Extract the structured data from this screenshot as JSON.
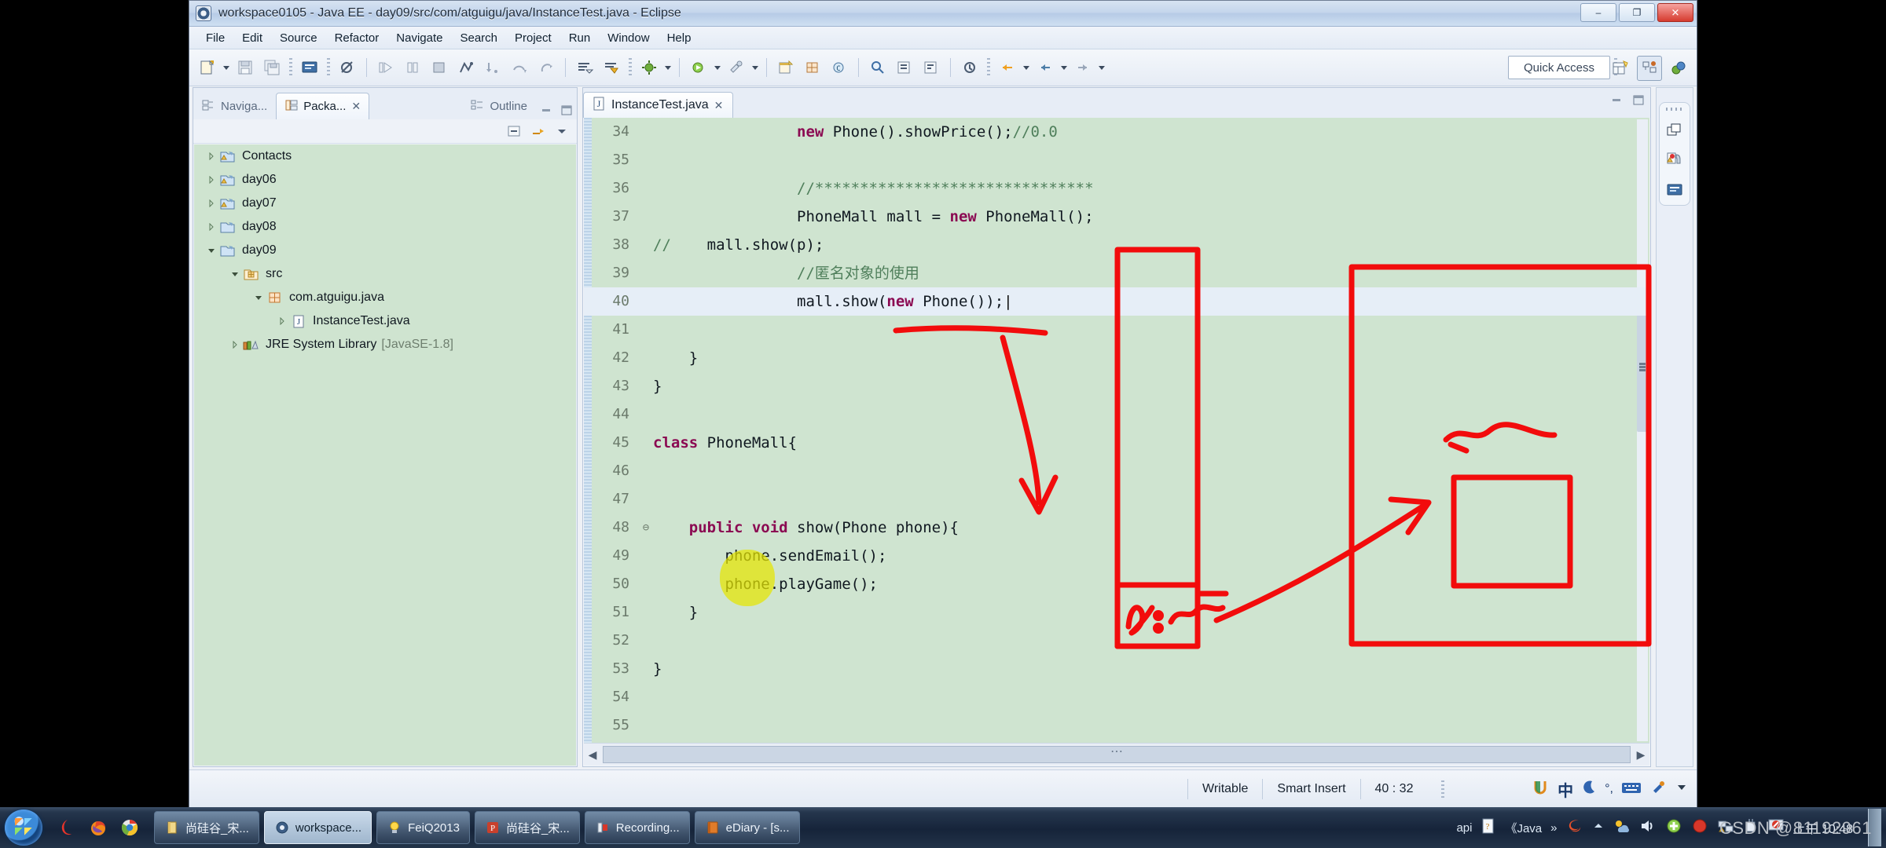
{
  "window": {
    "title": "workspace0105 - Java EE - day09/src/com/atguigu/java/InstanceTest.java - Eclipse",
    "minimize_label": "–",
    "maximize_label": "❐",
    "close_label": "✕"
  },
  "menu": [
    "File",
    "Edit",
    "Source",
    "Refactor",
    "Navigate",
    "Search",
    "Project",
    "Run",
    "Window",
    "Help"
  ],
  "toolbar": {
    "quick_access": "Quick Access",
    "icons": [
      "new-icon",
      "dropdown-caret",
      "save-icon",
      "save-all-icon",
      "console-icon",
      "skip-breakpoints-icon",
      "run-icon",
      "pause-icon",
      "stop-icon",
      "step-icon",
      "step-into-icon",
      "step-over-icon",
      "step-return-icon",
      "next-annotation-icon",
      "previous-annotation-icon",
      "debug-icon",
      "open-type-icon"
    ],
    "perspective_icons": [
      "new-perspective-icon",
      "java-ee-perspective-icon",
      "java-perspective-icon"
    ]
  },
  "left_panel": {
    "tabs": [
      {
        "label": "Naviga...",
        "icon": "navigator-icon",
        "active": false
      },
      {
        "label": "Packa...",
        "icon": "package-explorer-icon",
        "active": true
      }
    ],
    "close_label": "✕",
    "view_tools": [
      "collapse-all-icon",
      "link-with-editor-icon",
      "view-menu-icon"
    ],
    "minimize_label": "▭",
    "maximize_label": "▣",
    "tree": [
      {
        "label": "Contacts",
        "icon": "java-project-warning-icon",
        "indent": 0,
        "state": "collapsed"
      },
      {
        "label": "day06",
        "icon": "java-project-warning-icon",
        "indent": 0,
        "state": "collapsed"
      },
      {
        "label": "day07",
        "icon": "java-project-warning-icon",
        "indent": 0,
        "state": "collapsed"
      },
      {
        "label": "day08",
        "icon": "java-project-icon",
        "indent": 0,
        "state": "collapsed"
      },
      {
        "label": "day09",
        "icon": "java-project-icon",
        "indent": 0,
        "state": "expanded"
      },
      {
        "label": "src",
        "icon": "source-folder-icon",
        "indent": 1,
        "state": "expanded"
      },
      {
        "label": "com.atguigu.java",
        "icon": "package-icon",
        "indent": 2,
        "state": "expanded"
      },
      {
        "label": "InstanceTest.java",
        "icon": "java-file-icon",
        "indent": 3,
        "state": "collapsed"
      },
      {
        "label": "JRE System Library",
        "suffix": "[JavaSE-1.8]",
        "icon": "library-icon",
        "indent": 1,
        "state": "collapsed"
      }
    ]
  },
  "editor": {
    "tab": {
      "label": "InstanceTest.java",
      "icon": "java-file-icon",
      "close_label": "✕"
    },
    "minimize_label": "▭",
    "maximize_label": "▣",
    "cursor_line": 40,
    "lines": [
      {
        "n": 34,
        "fold": "",
        "indent": 4,
        "tokens": [
          {
            "t": "new",
            "c": "kw"
          },
          {
            "t": " Phone().showPrice();",
            "c": "src"
          },
          {
            "t": "//0.0",
            "c": "cm"
          }
        ]
      },
      {
        "n": 35,
        "fold": "",
        "indent": 0,
        "tokens": []
      },
      {
        "n": 36,
        "fold": "",
        "indent": 4,
        "tokens": [
          {
            "t": "//*******************************",
            "c": "cm"
          }
        ]
      },
      {
        "n": 37,
        "fold": "",
        "indent": 4,
        "tokens": [
          {
            "t": "PhoneMall mall = ",
            "c": "src"
          },
          {
            "t": "new",
            "c": "kw"
          },
          {
            "t": " PhoneMall();",
            "c": "src"
          }
        ]
      },
      {
        "n": 38,
        "fold": "",
        "indent": 0,
        "prefix": "//",
        "tokens": [
          {
            "t": "    mall.show(p);",
            "c": "src"
          }
        ]
      },
      {
        "n": 39,
        "fold": "",
        "indent": 4,
        "tokens": [
          {
            "t": "//匿名对象的使用",
            "c": "cm"
          }
        ]
      },
      {
        "n": 40,
        "fold": "",
        "indent": 4,
        "tokens": [
          {
            "t": "mall.show(",
            "c": "src"
          },
          {
            "t": "new",
            "c": "kw"
          },
          {
            "t": " Phone());",
            "c": "src"
          },
          {
            "t": "|",
            "c": "caret"
          }
        ]
      },
      {
        "n": 41,
        "fold": "",
        "indent": 0,
        "tokens": []
      },
      {
        "n": 42,
        "fold": "",
        "indent": 1,
        "tokens": [
          {
            "t": "}",
            "c": "src"
          }
        ]
      },
      {
        "n": 43,
        "fold": "",
        "indent": 0,
        "tokens": [
          {
            "t": "}",
            "c": "src"
          }
        ]
      },
      {
        "n": 44,
        "fold": "",
        "indent": 0,
        "tokens": []
      },
      {
        "n": 45,
        "fold": "",
        "indent": 0,
        "tokens": [
          {
            "t": "class",
            "c": "kw"
          },
          {
            "t": " PhoneMall{",
            "c": "src"
          }
        ]
      },
      {
        "n": 46,
        "fold": "",
        "indent": 0,
        "tokens": []
      },
      {
        "n": 47,
        "fold": "",
        "indent": 0,
        "tokens": []
      },
      {
        "n": 48,
        "fold": "⊖",
        "indent": 1,
        "tokens": [
          {
            "t": "public void",
            "c": "kw"
          },
          {
            "t": " show(Phone phone){",
            "c": "src"
          }
        ]
      },
      {
        "n": 49,
        "fold": "",
        "indent": 2,
        "tokens": [
          {
            "t": "phone.sendEmail();",
            "c": "src"
          }
        ]
      },
      {
        "n": 50,
        "fold": "",
        "indent": 2,
        "tokens": [
          {
            "t": "phone.playGame();",
            "c": "src"
          }
        ]
      },
      {
        "n": 51,
        "fold": "",
        "indent": 1,
        "tokens": [
          {
            "t": "}",
            "c": "src"
          }
        ]
      },
      {
        "n": 52,
        "fold": "",
        "indent": 0,
        "tokens": []
      },
      {
        "n": 53,
        "fold": "",
        "indent": 0,
        "tokens": [
          {
            "t": "}",
            "c": "src"
          }
        ]
      },
      {
        "n": 54,
        "fold": "",
        "indent": 0,
        "tokens": []
      },
      {
        "n": 55,
        "fold": "",
        "indent": 0,
        "tokens": []
      }
    ]
  },
  "fastview": {
    "icons": [
      "restore-icon",
      "problems-view-icon",
      "console-view-icon"
    ]
  },
  "status_bar": {
    "writable": "Writable",
    "insert_mode": "Smart Insert",
    "position": "40 : 32",
    "tray_icons": [
      "ime-u-icon",
      "ime-chinese-icon",
      "ime-halfwidth-icon",
      "ime-punctuation-icon",
      "ime-keyboard-icon",
      "ime-tools-icon",
      "ime-menu-icon"
    ]
  },
  "taskbar": {
    "start_label": "start-orb",
    "quick_launch": [
      "browser-360-icon",
      "firefox-icon",
      "chrome-icon"
    ],
    "tasks": [
      {
        "label": "尚硅谷_宋...",
        "icon": "notepad-icon",
        "active": false
      },
      {
        "label": "workspace...",
        "icon": "eclipse-icon",
        "active": true
      },
      {
        "label": "FeiQ2013",
        "icon": "feiq-icon",
        "active": false
      },
      {
        "label": "尚硅谷_宋...",
        "icon": "powerpoint-icon",
        "active": false
      },
      {
        "label": "Recording...",
        "icon": "recorder-icon",
        "active": false
      },
      {
        "label": "eDiary - [s...",
        "icon": "ediary-icon",
        "active": false
      }
    ],
    "tray": {
      "labels": [
        "api",
        "《Java",
        "»"
      ],
      "icons": [
        "sogou-icon",
        "show-hidden-arrow",
        "weather-icon",
        "volume-icon",
        "addon-icon",
        "stop-record-icon",
        "network-icon",
        "usb-icon",
        "safety-icon"
      ],
      "clock": "上午 10:48"
    }
  },
  "watermark": "CSDN @81192961",
  "colors": {
    "ink_red": "#f20c0c",
    "highlighter_yellow": "#e4e400",
    "editor_background": "#cfe4d0",
    "keyword": "#8b0a52",
    "comment": "#4f7f5b"
  }
}
